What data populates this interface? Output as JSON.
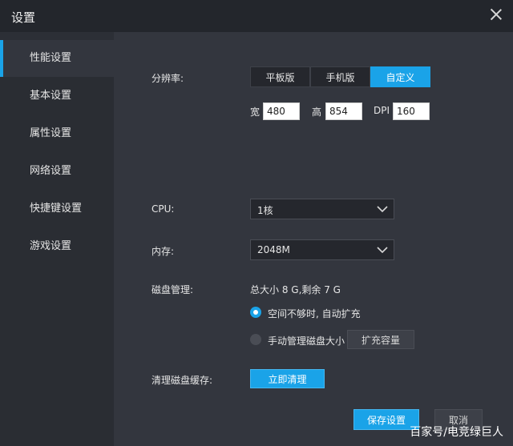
{
  "window": {
    "title": "设置"
  },
  "sidebar": {
    "items": [
      {
        "label": "性能设置"
      },
      {
        "label": "基本设置"
      },
      {
        "label": "属性设置"
      },
      {
        "label": "网络设置"
      },
      {
        "label": "快捷键设置"
      },
      {
        "label": "游戏设置"
      }
    ]
  },
  "resolution": {
    "label": "分辨率:",
    "options": [
      "平板版",
      "手机版",
      "自定义"
    ],
    "selected": "自定义",
    "width_label": "宽",
    "width_value": "480",
    "height_label": "高",
    "height_value": "854",
    "dpi_label": "DPI",
    "dpi_value": "160"
  },
  "cpu": {
    "label": "CPU:",
    "value": "1核"
  },
  "memory": {
    "label": "内存:",
    "value": "2048M"
  },
  "disk": {
    "label": "磁盘管理:",
    "summary": "总大小 8 G,剩余 7 G",
    "option_auto": "空间不够时, 自动扩充",
    "option_manual": "手动管理磁盘大小",
    "expand_button": "扩充容量"
  },
  "cache": {
    "label": "清理磁盘缓存:",
    "clean_button": "立即清理"
  },
  "footer": {
    "save_button": "保存设置",
    "cancel_button": "取消"
  },
  "watermark": "百家号/电竞绿巨人",
  "colors": {
    "accent": "#1aa3e8",
    "background": "#33363e",
    "sidebar": "#2a2d33"
  }
}
